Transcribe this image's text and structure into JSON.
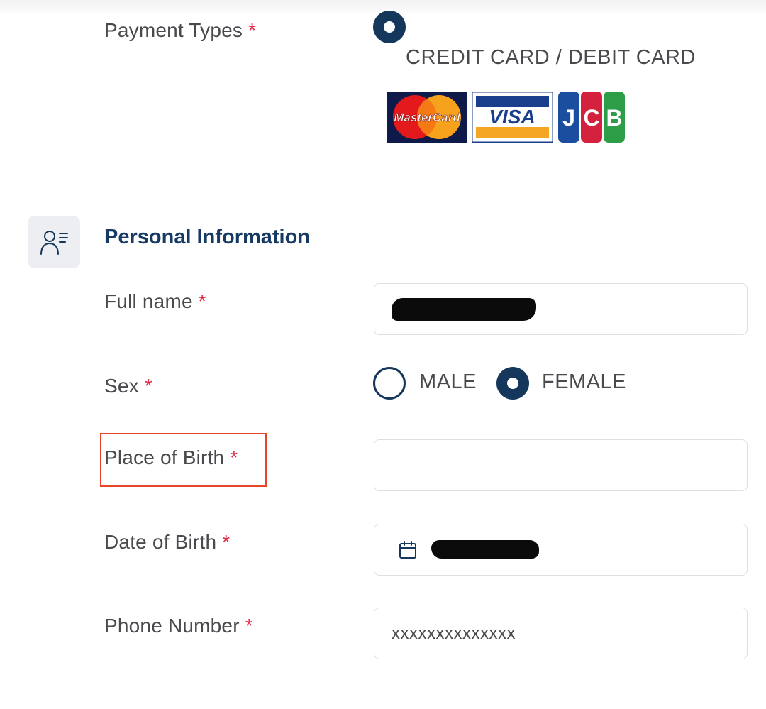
{
  "payment": {
    "label": "Payment Types",
    "required_mark": "*",
    "option_label": "CREDIT CARD / DEBIT CARD",
    "option_selected": true,
    "card_logos": [
      {
        "name": "mastercard-logo",
        "text": "MasterCard"
      },
      {
        "name": "visa-logo",
        "text": "VISA"
      },
      {
        "name": "jcb-logo",
        "text": "JCB"
      }
    ]
  },
  "personal_info": {
    "title": "Personal Information",
    "icon": "user-details-icon"
  },
  "fields": {
    "full_name": {
      "label": "Full name",
      "required_mark": "*",
      "value": "[redacted]"
    },
    "sex": {
      "label": "Sex",
      "required_mark": "*",
      "options": [
        {
          "label": "MALE",
          "selected": false
        },
        {
          "label": "FEMALE",
          "selected": true
        }
      ]
    },
    "place_of_birth": {
      "label": "Place of Birth",
      "required_mark": "*",
      "value": ""
    },
    "date_of_birth": {
      "label": "Date of Birth",
      "required_mark": "*",
      "value": "[redacted]",
      "icon": "calendar-icon"
    },
    "phone_number": {
      "label": "Phone Number",
      "required_mark": "*",
      "value": "xxxxxxxxxxxxxx"
    }
  },
  "colors": {
    "accent": "#15375c",
    "required": "#e0314b",
    "highlight": "#e8442c",
    "text": "#4a4a4e"
  }
}
